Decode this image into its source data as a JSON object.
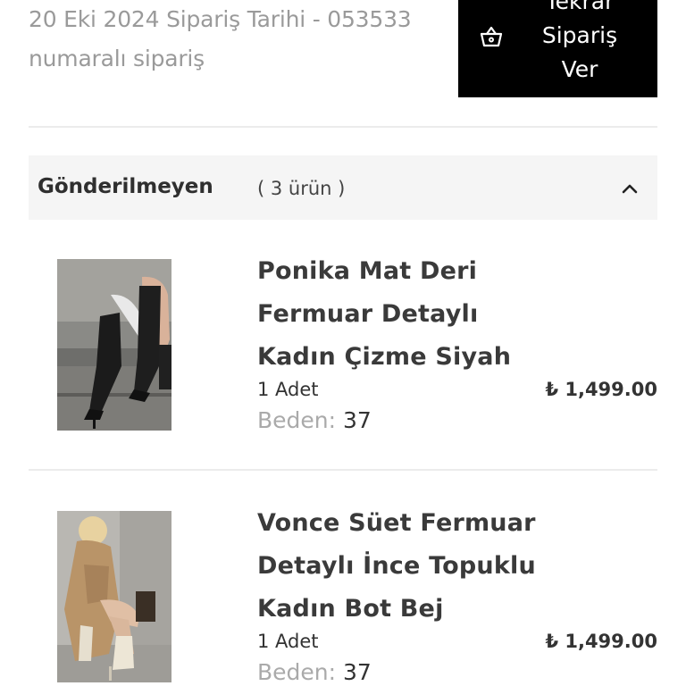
{
  "order": {
    "info_line1": "20 Eki 2024 Sipariş Tarihi - 053533",
    "info_line2": "numaralı sipariş"
  },
  "reorder_button": {
    "line1": "Tekrar",
    "line2": "Sipariş",
    "line3": "Ver",
    "icon": "basket-icon"
  },
  "section": {
    "title": "Gönderilmeyen",
    "count": "( 3 ürün )",
    "icon": "chevron-up-icon"
  },
  "products": [
    {
      "name": "Ponika Mat Deri Fermuar Detaylı Kadın Çizme Siyah",
      "quantity": "1 Adet",
      "price": "₺ 1,499.00",
      "size_label": "Beden:",
      "size_value": "37"
    },
    {
      "name": "Vonce Süet Fermuar Detaylı İnce Topuklu Kadın Bot Bej",
      "quantity": "1 Adet",
      "price": "₺ 1,499.00",
      "size_label": "Beden:",
      "size_value": "37"
    }
  ]
}
